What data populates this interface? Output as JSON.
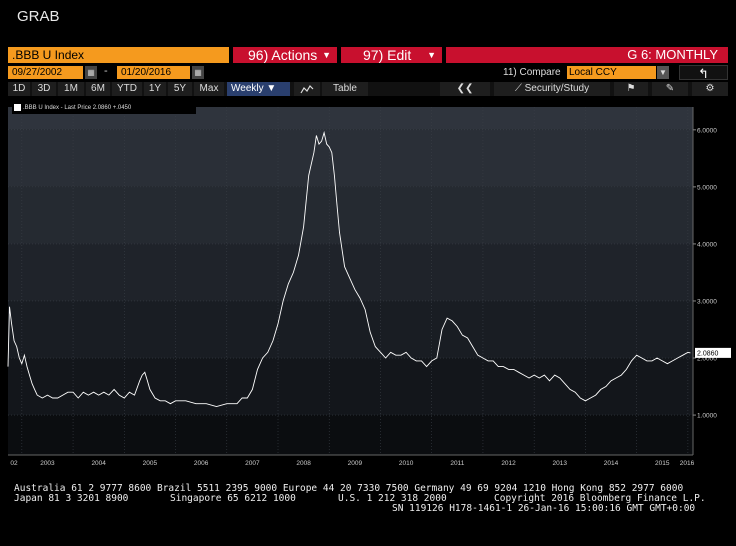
{
  "window_title": "GRAB",
  "header": {
    "ticker": ".BBB U Index",
    "actions_label": "96) Actions",
    "edit_label": "97) Edit",
    "graph_mode": "G 6: MONTHLY",
    "start_date": "09/27/2002",
    "date_sep": "-",
    "end_date": "01/20/2016",
    "compare_label": "11) Compare",
    "compare_value": "Local CCY",
    "calendar_icon": "calendar-icon",
    "back_icon": "back-arrow-icon"
  },
  "toolbar": {
    "ranges": [
      "1D",
      "3D",
      "1M",
      "6M",
      "YTD",
      "1Y",
      "5Y",
      "Max"
    ],
    "frequency": "Weekly",
    "table_label": "Table",
    "security_study": "Security/Study"
  },
  "colors": {
    "orange": "#f59a1e",
    "red": "#c8102e",
    "line": "#ffffff",
    "selected": "#2a3f6e"
  },
  "chart_data": {
    "type": "line",
    "legend": ".BBB U Index - Last Price 2.0860 +.0450",
    "last_price_label": "2.0860",
    "y_ticks": [
      "1.0000",
      "2.0000",
      "3.0000",
      "4.0000",
      "5.0000",
      "6.0000"
    ],
    "ylim": [
      0.3,
      6.4
    ],
    "x_ticks": [
      "02",
      "2003",
      "2004",
      "2005",
      "2006",
      "2007",
      "2008",
      "2009",
      "2010",
      "2011",
      "2012",
      "2013",
      "2014",
      "2015",
      "2016"
    ],
    "xlim": [
      2002.73,
      2016.1
    ],
    "series": [
      {
        "x": [
          2002.73,
          2002.76,
          2002.8,
          2002.85,
          2002.9,
          2002.95,
          2003.0,
          2003.05,
          2003.1,
          2003.15,
          2003.2,
          2003.25,
          2003.3,
          2003.4,
          2003.5,
          2003.6,
          2003.7,
          2003.8,
          2003.9,
          2004.0,
          2004.1,
          2004.2,
          2004.3,
          2004.4,
          2004.5,
          2004.6,
          2004.7,
          2004.8,
          2004.9,
          2005.0,
          2005.1,
          2005.2,
          2005.3,
          2005.35,
          2005.4,
          2005.45,
          2005.5,
          2005.6,
          2005.7,
          2005.8,
          2005.9,
          2006.0,
          2006.2,
          2006.4,
          2006.6,
          2006.8,
          2007.0,
          2007.2,
          2007.3,
          2007.4,
          2007.5,
          2007.6,
          2007.7,
          2007.8,
          2007.9,
          2008.0,
          2008.1,
          2008.2,
          2008.3,
          2008.4,
          2008.5,
          2008.6,
          2008.7,
          2008.75,
          2008.8,
          2008.85,
          2008.9,
          2008.95,
          2009.0,
          2009.05,
          2009.1,
          2009.15,
          2009.2,
          2009.3,
          2009.4,
          2009.5,
          2009.6,
          2009.7,
          2009.8,
          2009.9,
          2010.0,
          2010.1,
          2010.2,
          2010.3,
          2010.4,
          2010.5,
          2010.6,
          2010.7,
          2010.8,
          2010.9,
          2011.0,
          2011.1,
          2011.2,
          2011.3,
          2011.4,
          2011.5,
          2011.6,
          2011.7,
          2011.8,
          2011.9,
          2012.0,
          2012.1,
          2012.2,
          2012.3,
          2012.4,
          2012.5,
          2012.6,
          2012.7,
          2012.8,
          2012.9,
          2013.0,
          2013.1,
          2013.2,
          2013.3,
          2013.4,
          2013.5,
          2013.6,
          2013.7,
          2013.8,
          2013.9,
          2014.0,
          2014.1,
          2014.2,
          2014.3,
          2014.4,
          2014.5,
          2014.6,
          2014.7,
          2014.8,
          2014.9,
          2015.0,
          2015.1,
          2015.2,
          2015.3,
          2015.4,
          2015.5,
          2015.6,
          2015.7,
          2015.8,
          2015.9,
          2016.0,
          2016.05
        ],
        "y": [
          1.85,
          2.9,
          2.6,
          2.3,
          2.2,
          2.0,
          1.9,
          2.05,
          1.85,
          1.7,
          1.55,
          1.45,
          1.35,
          1.3,
          1.35,
          1.3,
          1.3,
          1.35,
          1.4,
          1.4,
          1.3,
          1.4,
          1.35,
          1.4,
          1.35,
          1.4,
          1.35,
          1.45,
          1.35,
          1.3,
          1.4,
          1.35,
          1.6,
          1.7,
          1.75,
          1.6,
          1.45,
          1.3,
          1.25,
          1.25,
          1.2,
          1.25,
          1.25,
          1.2,
          1.2,
          1.15,
          1.2,
          1.2,
          1.3,
          1.3,
          1.45,
          1.8,
          2.0,
          2.1,
          2.3,
          2.6,
          3.0,
          3.3,
          3.5,
          3.8,
          4.3,
          5.2,
          5.6,
          5.9,
          5.75,
          5.8,
          5.95,
          5.75,
          5.7,
          5.6,
          5.2,
          4.7,
          4.2,
          3.6,
          3.4,
          3.2,
          3.05,
          2.85,
          2.45,
          2.2,
          2.1,
          2.0,
          2.1,
          2.05,
          2.05,
          2.1,
          2.0,
          1.95,
          1.95,
          1.85,
          1.95,
          2.0,
          2.5,
          2.7,
          2.65,
          2.55,
          2.4,
          2.35,
          2.2,
          2.05,
          2.0,
          1.95,
          1.95,
          1.85,
          1.85,
          1.8,
          1.8,
          1.75,
          1.7,
          1.65,
          1.7,
          1.65,
          1.7,
          1.6,
          1.7,
          1.65,
          1.55,
          1.45,
          1.4,
          1.3,
          1.25,
          1.3,
          1.35,
          1.45,
          1.5,
          1.6,
          1.65,
          1.7,
          1.8,
          1.95,
          2.05,
          2.0,
          1.95,
          1.95,
          2.0,
          1.95,
          1.9,
          1.95,
          2.0,
          2.05,
          2.1,
          2.09
        ]
      }
    ]
  },
  "footer": {
    "line1": "Australia 61 2 9777 8600 Brazil 5511 2395 9000 Europe 44 20 7330 7500 Germany 49 69 9204 1210 Hong Kong 852 2977 6000",
    "line2a": "Japan 81 3 3201 8900",
    "line2b": "Singapore 65 6212 1000",
    "line2c": "U.S. 1 212 318 2000",
    "line2d": "Copyright 2016 Bloomberg Finance L.P.",
    "line3": "SN 119126 H178-1461-1 26-Jan-16 15:00:16 GMT GMT+0:00"
  }
}
